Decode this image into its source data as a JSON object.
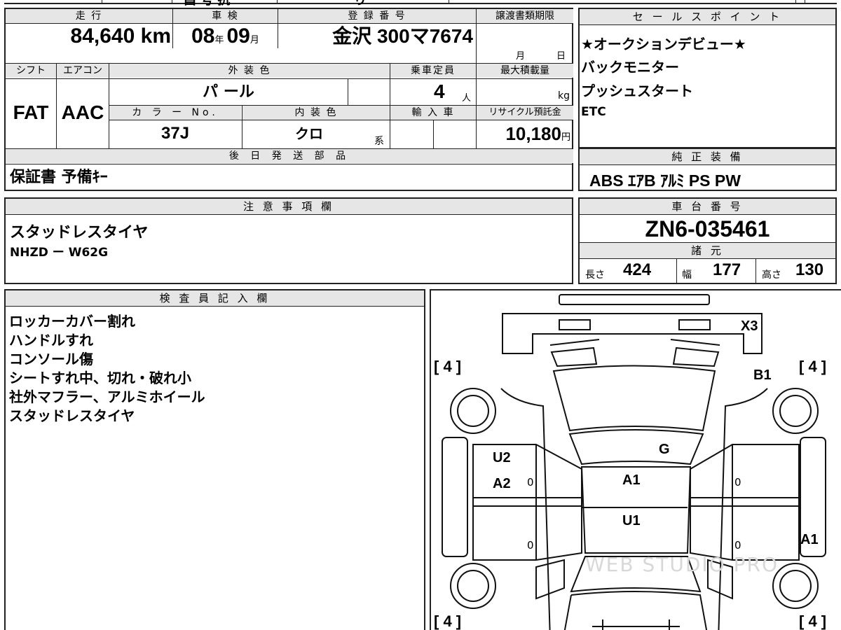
{
  "top": {
    "partial_1": "昌 号 抗",
    "partial_2": "り"
  },
  "main_table": {
    "mileage_label": "走 行",
    "mileage_value": "84,640 km",
    "inspection_label": "車 検",
    "inspection_year": "08",
    "inspection_year_unit": "年",
    "inspection_month": "09",
    "inspection_month_unit": "月",
    "registration_label": "登 録 番 号",
    "registration_value": "金沢 300マ7674",
    "transfer_label": "譲渡書類期限",
    "transfer_month": "月",
    "transfer_day": "日",
    "shift_label": "シフト",
    "shift_value": "FAT",
    "ac_label": "エアコン",
    "ac_value": "AAC",
    "exterior_label": "外 装 色",
    "exterior_value": "パ ール",
    "capacity_label": "乗車定員",
    "capacity_value": "4",
    "capacity_unit": "人",
    "max_load_label": "最大積載量",
    "max_load_unit": "kg",
    "color_no_label": "カ ラ ー No.",
    "color_no_value": "37J",
    "interior_label": "内 装 色",
    "interior_value": "クロ",
    "interior_suffix": "系",
    "import_label": "輸 入 車",
    "recycle_label": "リサイクル預託金",
    "recycle_value": "10,180",
    "recycle_unit": "円"
  },
  "later_parts": {
    "label": "後 日 発 送 部 品",
    "value": "保証書 予備ｷｰ"
  },
  "sales_points": {
    "label": "セ ー ル ス ポ イ ン ト",
    "lines": [
      "★オークションデビュー★",
      "バックモニター",
      "プッシュスタート",
      "ETC"
    ]
  },
  "equipment": {
    "label": "純 正 装 備",
    "value": "ABS ｴｱB ｱﾙﾐ PS PW"
  },
  "notes": {
    "label": "注 意 事 項 欄",
    "lines": [
      "スタッドレスタイヤ",
      "NHZD ー W62G"
    ]
  },
  "chassis": {
    "label": "車 台 番 号",
    "value": "ZN6-035461",
    "specs_label": "諸 元",
    "length_label": "長さ",
    "length_value": "424",
    "width_label": "幅",
    "width_value": "177",
    "height_label": "高さ",
    "height_value": "130"
  },
  "inspector": {
    "label": "検 査 員 記 入 欄",
    "lines": [
      "ロッカーカバー割れ",
      "ハンドルすれ",
      "コンソール傷",
      "シートすれ中、切れ・破れ小",
      "社外マフラー、アルミホイール",
      "スタッドレスタイヤ"
    ]
  },
  "diagram": {
    "tire_fl": "[ 4 ]",
    "tire_fr": "[ 4 ]",
    "tire_rl": "[ 4 ]",
    "tire_rr": "[ 4 ]",
    "mark_x3": "X3",
    "mark_b1": "B1",
    "mark_g": "G",
    "mark_u2": "U2",
    "mark_a2": "A2",
    "mark_a1_roof": "A1",
    "mark_u1": "U1",
    "mark_a1_side": "A1",
    "zero": "0",
    "watermark": "WEB STUDIO PRO"
  }
}
